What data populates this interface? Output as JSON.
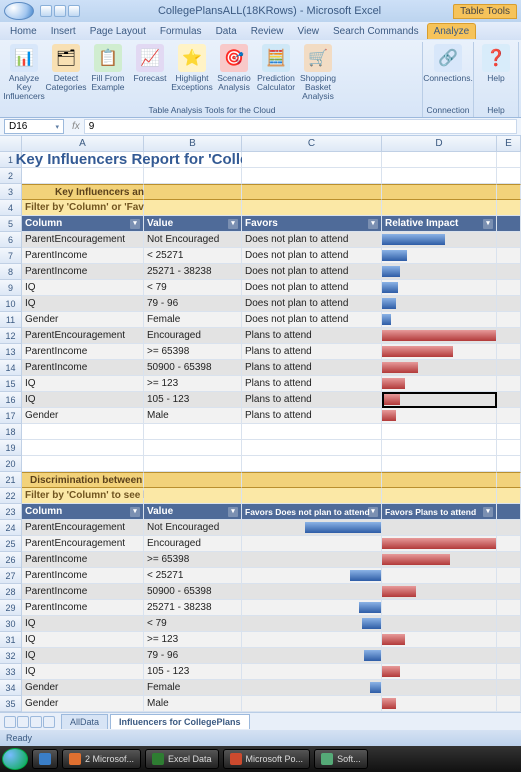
{
  "app": {
    "title": "CollegePlansALL(18KRows) - Microsoft Excel",
    "table_tools": "Table Tools"
  },
  "tabs": {
    "home": "Home",
    "insert": "Insert",
    "page": "Page Layout",
    "formulas": "Formulas",
    "data": "Data",
    "review": "Review",
    "view": "View",
    "search": "Search Commands",
    "analyze": "Analyze"
  },
  "ribbon": {
    "analyze_key": "Analyze Key Influencers",
    "detect_cat": "Detect Categories",
    "fill_from": "Fill From Example",
    "forecast": "Forecast",
    "highlight": "Highlight Exceptions",
    "scenario": "Scenario Analysis",
    "prediction": "Prediction Calculator",
    "shopping": "Shopping Basket Analysis",
    "connections": "Connections.",
    "help": "Help",
    "group1": "Table Analysis Tools for the Cloud",
    "group_conn": "Connection",
    "group_help": "Help"
  },
  "fx": {
    "name_box": "D16",
    "formula": "9"
  },
  "col_headers": {
    "A": "A",
    "B": "B",
    "C": "C",
    "D": "D",
    "E": "E"
  },
  "report": {
    "title": "Key Influencers Report for 'CollegePlans'",
    "section1": "Key Influencers and their impact over the values of 'CollegePlans'",
    "filter1": "Filter by 'Column' or 'Favors' to see how various columns influence 'CollegePlans'",
    "hdr1": {
      "col": "Column",
      "val": "Value",
      "fav": "Favors",
      "impact": "Relative Impact"
    },
    "t1": [
      {
        "c": "ParentEncouragement",
        "v": "Not Encouraged",
        "f": "Does not plan to attend",
        "bar": 55,
        "color": "blue"
      },
      {
        "c": "ParentIncome",
        "v": "< 25271",
        "f": "Does not plan to attend",
        "bar": 22,
        "color": "blue"
      },
      {
        "c": "ParentIncome",
        "v": "25271 - 38238",
        "f": "Does not plan to attend",
        "bar": 16,
        "color": "blue"
      },
      {
        "c": "IQ",
        "v": "< 79",
        "f": "Does not plan to attend",
        "bar": 14,
        "color": "blue"
      },
      {
        "c": "IQ",
        "v": "79 - 96",
        "f": "Does not plan to attend",
        "bar": 12,
        "color": "blue"
      },
      {
        "c": "Gender",
        "v": "Female",
        "f": "Does not plan to attend",
        "bar": 8,
        "color": "blue"
      },
      {
        "c": "ParentEncouragement",
        "v": "Encouraged",
        "f": "Plans to attend",
        "bar": 100,
        "color": "red"
      },
      {
        "c": "ParentIncome",
        "v": ">= 65398",
        "f": "Plans to attend",
        "bar": 62,
        "color": "red"
      },
      {
        "c": "ParentIncome",
        "v": "50900 - 65398",
        "f": "Plans to attend",
        "bar": 32,
        "color": "red"
      },
      {
        "c": "IQ",
        "v": ">= 123",
        "f": "Plans to attend",
        "bar": 20,
        "color": "red"
      },
      {
        "c": "IQ",
        "v": "105 - 123",
        "f": "Plans to attend",
        "bar": 16,
        "color": "red"
      },
      {
        "c": "Gender",
        "v": "Male",
        "f": "Plans to attend",
        "bar": 12,
        "color": "red"
      }
    ],
    "section2": "Discrimination between factors leading to 'Does not plan to attend' and 'Plans to attend'",
    "filter2": "Filter by 'Column' to see how different values favor 'Does not plan to attend' or 'Plans to attend'",
    "hdr2": {
      "col": "Column",
      "val": "Value",
      "no": "Favors Does not plan to attend",
      "yes": "Favors Plans to attend"
    },
    "t2": [
      {
        "c": "ParentEncouragement",
        "v": "Not Encouraged",
        "no": 55,
        "yes": 0
      },
      {
        "c": "ParentEncouragement",
        "v": "Encouraged",
        "no": 0,
        "yes": 100
      },
      {
        "c": "ParentIncome",
        "v": ">= 65398",
        "no": 0,
        "yes": 60
      },
      {
        "c": "ParentIncome",
        "v": "< 25271",
        "no": 22,
        "yes": 0
      },
      {
        "c": "ParentIncome",
        "v": "50900 - 65398",
        "no": 0,
        "yes": 30
      },
      {
        "c": "ParentIncome",
        "v": "25271 - 38238",
        "no": 16,
        "yes": 0
      },
      {
        "c": "IQ",
        "v": "< 79",
        "no": 14,
        "yes": 0
      },
      {
        "c": "IQ",
        "v": ">= 123",
        "no": 0,
        "yes": 20
      },
      {
        "c": "IQ",
        "v": "79 - 96",
        "no": 12,
        "yes": 0
      },
      {
        "c": "IQ",
        "v": "105 - 123",
        "no": 0,
        "yes": 16
      },
      {
        "c": "Gender",
        "v": "Female",
        "no": 8,
        "yes": 0
      },
      {
        "c": "Gender",
        "v": "Male",
        "no": 0,
        "yes": 12
      }
    ]
  },
  "sheet_tabs": {
    "all": "AllData",
    "infl": "Influencers for CollegePlans"
  },
  "status": "Ready",
  "taskbar": {
    "t1": "",
    "t2": "2 Microsof...",
    "t3": "Excel Data",
    "t4": "Microsoft Po...",
    "t5": "Soft..."
  }
}
